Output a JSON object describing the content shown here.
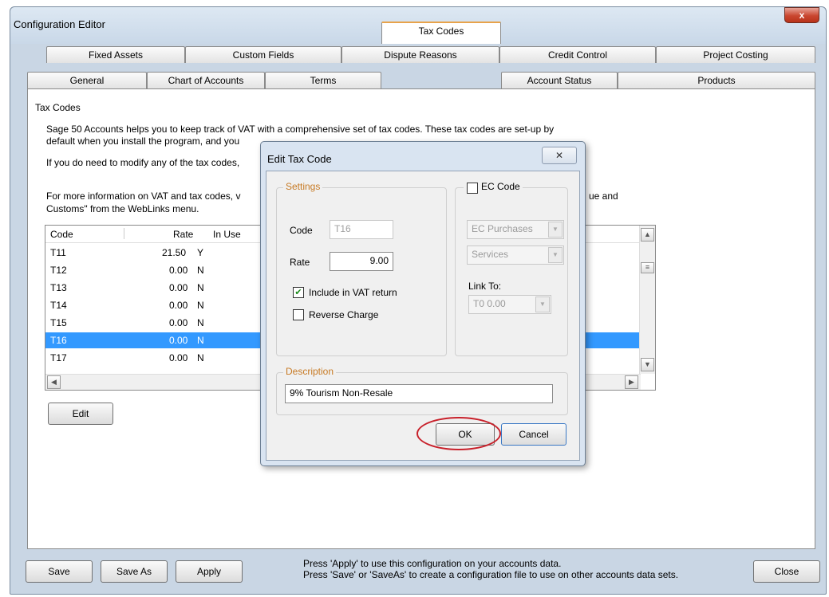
{
  "window": {
    "title": "Configuration Editor",
    "close_glyph": "x"
  },
  "tabs_back": [
    "Fixed Assets",
    "Custom Fields",
    "Dispute Reasons",
    "Credit Control",
    "Project Costing"
  ],
  "tabs_front": [
    "General",
    "Chart of Accounts",
    "Terms",
    "Tax Codes",
    "Account Status",
    "Products"
  ],
  "panel": {
    "heading": "Tax Codes",
    "para1_line1": "Sage 50 Accounts helps you to keep track of VAT with a comprehensive set of tax codes. These tax codes are set-up by",
    "para1_line2": "default when you install the program, and you",
    "para2": "If you do need to modify any of the tax codes,",
    "para3_line1": "For more information on VAT and tax codes, v",
    "para3_line1_tail": "ue and",
    "para3_line2": "Customs\" from the WebLinks menu.",
    "edit_label": "Edit"
  },
  "grid": {
    "headers": {
      "code": "Code",
      "rate": "Rate",
      "in_use": "In Use"
    },
    "rows": [
      {
        "code": "T11",
        "rate": "21.50",
        "in_use": "Y"
      },
      {
        "code": "T12",
        "rate": "0.00",
        "in_use": "N"
      },
      {
        "code": "T13",
        "rate": "0.00",
        "in_use": "N"
      },
      {
        "code": "T14",
        "rate": "0.00",
        "in_use": "N"
      },
      {
        "code": "T15",
        "rate": "0.00",
        "in_use": "N"
      },
      {
        "code": "T16",
        "rate": "0.00",
        "in_use": "N"
      },
      {
        "code": "T17",
        "rate": "0.00",
        "in_use": "N"
      }
    ],
    "selected_code": "T16"
  },
  "dialog": {
    "title": "Edit Tax Code",
    "close_glyph": "✕",
    "settings_label": "Settings",
    "code_label": "Code",
    "code_value": "T16",
    "rate_label": "Rate",
    "rate_value": "9.00",
    "include_vat_label": "Include in VAT return",
    "include_vat_checked": true,
    "reverse_charge_label": "Reverse Charge",
    "reverse_charge_checked": false,
    "ec_code_label": "EC Code",
    "ec_code_checked": false,
    "ec_purchases_value": "EC Purchases",
    "services_value": "Services",
    "link_to_label": "Link To:",
    "link_to_value": "T0 0.00",
    "description_label": "Description",
    "description_value": "9% Tourism Non-Resale",
    "ok_label": "OK",
    "cancel_label": "Cancel"
  },
  "footer": {
    "save_label": "Save",
    "save_as_label": "Save As",
    "apply_label": "Apply",
    "close_label": "Close",
    "note_line1": "Press 'Apply' to use this configuration on your accounts data.",
    "note_line2": "Press 'Save' or 'SaveAs' to create a configuration file to use on other accounts data sets."
  }
}
